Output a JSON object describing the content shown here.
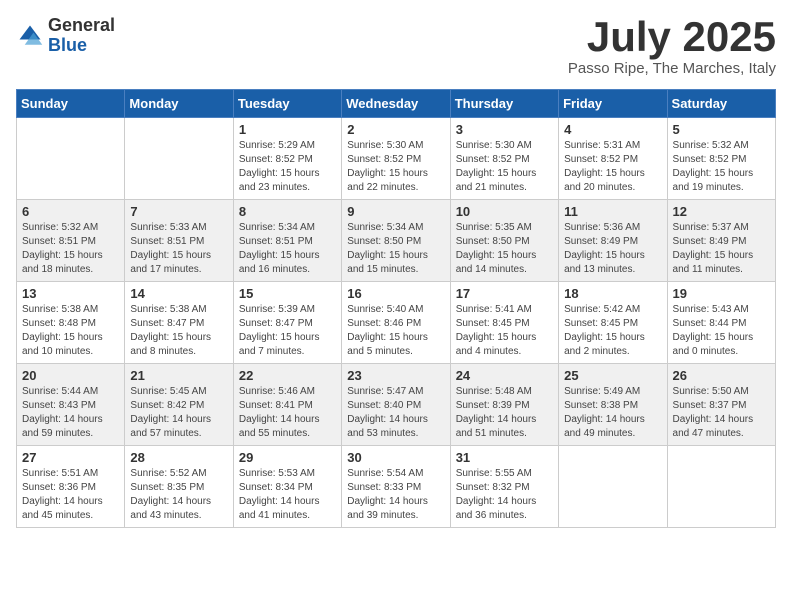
{
  "logo": {
    "general": "General",
    "blue": "Blue"
  },
  "title": "July 2025",
  "location": "Passo Ripe, The Marches, Italy",
  "days": [
    "Sunday",
    "Monday",
    "Tuesday",
    "Wednesday",
    "Thursday",
    "Friday",
    "Saturday"
  ],
  "weeks": [
    [
      {
        "day": "",
        "content": ""
      },
      {
        "day": "",
        "content": ""
      },
      {
        "day": "1",
        "content": "Sunrise: 5:29 AM\nSunset: 8:52 PM\nDaylight: 15 hours\nand 23 minutes."
      },
      {
        "day": "2",
        "content": "Sunrise: 5:30 AM\nSunset: 8:52 PM\nDaylight: 15 hours\nand 22 minutes."
      },
      {
        "day": "3",
        "content": "Sunrise: 5:30 AM\nSunset: 8:52 PM\nDaylight: 15 hours\nand 21 minutes."
      },
      {
        "day": "4",
        "content": "Sunrise: 5:31 AM\nSunset: 8:52 PM\nDaylight: 15 hours\nand 20 minutes."
      },
      {
        "day": "5",
        "content": "Sunrise: 5:32 AM\nSunset: 8:52 PM\nDaylight: 15 hours\nand 19 minutes."
      }
    ],
    [
      {
        "day": "6",
        "content": "Sunrise: 5:32 AM\nSunset: 8:51 PM\nDaylight: 15 hours\nand 18 minutes."
      },
      {
        "day": "7",
        "content": "Sunrise: 5:33 AM\nSunset: 8:51 PM\nDaylight: 15 hours\nand 17 minutes."
      },
      {
        "day": "8",
        "content": "Sunrise: 5:34 AM\nSunset: 8:51 PM\nDaylight: 15 hours\nand 16 minutes."
      },
      {
        "day": "9",
        "content": "Sunrise: 5:34 AM\nSunset: 8:50 PM\nDaylight: 15 hours\nand 15 minutes."
      },
      {
        "day": "10",
        "content": "Sunrise: 5:35 AM\nSunset: 8:50 PM\nDaylight: 15 hours\nand 14 minutes."
      },
      {
        "day": "11",
        "content": "Sunrise: 5:36 AM\nSunset: 8:49 PM\nDaylight: 15 hours\nand 13 minutes."
      },
      {
        "day": "12",
        "content": "Sunrise: 5:37 AM\nSunset: 8:49 PM\nDaylight: 15 hours\nand 11 minutes."
      }
    ],
    [
      {
        "day": "13",
        "content": "Sunrise: 5:38 AM\nSunset: 8:48 PM\nDaylight: 15 hours\nand 10 minutes."
      },
      {
        "day": "14",
        "content": "Sunrise: 5:38 AM\nSunset: 8:47 PM\nDaylight: 15 hours\nand 8 minutes."
      },
      {
        "day": "15",
        "content": "Sunrise: 5:39 AM\nSunset: 8:47 PM\nDaylight: 15 hours\nand 7 minutes."
      },
      {
        "day": "16",
        "content": "Sunrise: 5:40 AM\nSunset: 8:46 PM\nDaylight: 15 hours\nand 5 minutes."
      },
      {
        "day": "17",
        "content": "Sunrise: 5:41 AM\nSunset: 8:45 PM\nDaylight: 15 hours\nand 4 minutes."
      },
      {
        "day": "18",
        "content": "Sunrise: 5:42 AM\nSunset: 8:45 PM\nDaylight: 15 hours\nand 2 minutes."
      },
      {
        "day": "19",
        "content": "Sunrise: 5:43 AM\nSunset: 8:44 PM\nDaylight: 15 hours\nand 0 minutes."
      }
    ],
    [
      {
        "day": "20",
        "content": "Sunrise: 5:44 AM\nSunset: 8:43 PM\nDaylight: 14 hours\nand 59 minutes."
      },
      {
        "day": "21",
        "content": "Sunrise: 5:45 AM\nSunset: 8:42 PM\nDaylight: 14 hours\nand 57 minutes."
      },
      {
        "day": "22",
        "content": "Sunrise: 5:46 AM\nSunset: 8:41 PM\nDaylight: 14 hours\nand 55 minutes."
      },
      {
        "day": "23",
        "content": "Sunrise: 5:47 AM\nSunset: 8:40 PM\nDaylight: 14 hours\nand 53 minutes."
      },
      {
        "day": "24",
        "content": "Sunrise: 5:48 AM\nSunset: 8:39 PM\nDaylight: 14 hours\nand 51 minutes."
      },
      {
        "day": "25",
        "content": "Sunrise: 5:49 AM\nSunset: 8:38 PM\nDaylight: 14 hours\nand 49 minutes."
      },
      {
        "day": "26",
        "content": "Sunrise: 5:50 AM\nSunset: 8:37 PM\nDaylight: 14 hours\nand 47 minutes."
      }
    ],
    [
      {
        "day": "27",
        "content": "Sunrise: 5:51 AM\nSunset: 8:36 PM\nDaylight: 14 hours\nand 45 minutes."
      },
      {
        "day": "28",
        "content": "Sunrise: 5:52 AM\nSunset: 8:35 PM\nDaylight: 14 hours\nand 43 minutes."
      },
      {
        "day": "29",
        "content": "Sunrise: 5:53 AM\nSunset: 8:34 PM\nDaylight: 14 hours\nand 41 minutes."
      },
      {
        "day": "30",
        "content": "Sunrise: 5:54 AM\nSunset: 8:33 PM\nDaylight: 14 hours\nand 39 minutes."
      },
      {
        "day": "31",
        "content": "Sunrise: 5:55 AM\nSunset: 8:32 PM\nDaylight: 14 hours\nand 36 minutes."
      },
      {
        "day": "",
        "content": ""
      },
      {
        "day": "",
        "content": ""
      }
    ]
  ]
}
